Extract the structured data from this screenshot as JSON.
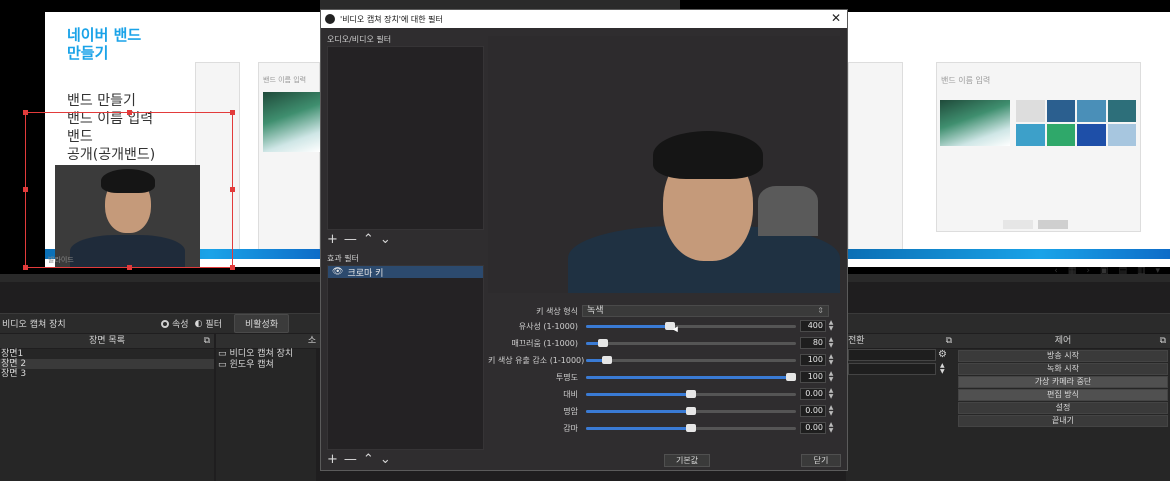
{
  "left_slide": {
    "title": "네이버 밴드\n만들기",
    "body": "밴드 만들기\n밴드 이름 입력\n밴드\n공개(공개밴드)",
    "footer_label": "발라이드",
    "mock_title": "밴드 이름 입력"
  },
  "right_slide": {
    "mock_title": "밴드 이름 입력"
  },
  "toolbar": {
    "source_name": "비디오 캡쳐 장치",
    "properties_label": "속성",
    "filters_label": "필터",
    "deactivate_label": "비활성화"
  },
  "scenes": {
    "header": "장면 목록",
    "items": [
      "장면1",
      "장면 2",
      "장면 3"
    ]
  },
  "sources": {
    "header": "소스",
    "items": [
      "비디오 캡쳐 장치",
      "윈도우 캡쳐"
    ]
  },
  "mixer": {
    "header": "전환"
  },
  "controls": {
    "header": "제어",
    "buttons": [
      "방송 시작",
      "녹화 시작",
      "가상 카메라 중단",
      "편집 방식",
      "설정",
      "끝내기"
    ]
  },
  "dialog": {
    "title": "'비디오 캡쳐 장치'에 대한 필터",
    "audio_video_filters_label": "오디오/비디오 필터",
    "effect_filters_label": "효과 필터",
    "effect_filter_item": "크로마 키",
    "defaults_button": "기본값",
    "close_button": "닫기",
    "tools": {
      "add": "+",
      "remove": "—",
      "up": "⌃",
      "down": "⌄"
    },
    "key_color_type_label": "키 색상 형식",
    "key_color_type_value": "녹색",
    "params": [
      {
        "label": "유사성 (1-1000)",
        "value": "400",
        "fraction": 0.4
      },
      {
        "label": "매끄러움 (1-1000)",
        "value": "80",
        "fraction": 0.08
      },
      {
        "label": "키 색상 유출 감소 (1-1000)",
        "value": "100",
        "fraction": 0.1
      },
      {
        "label": "투명도",
        "value": "100",
        "fraction": 1.0
      },
      {
        "label": "대비",
        "value": "0.00",
        "fraction": 0.5
      },
      {
        "label": "명암",
        "value": "0.00",
        "fraction": 0.5
      },
      {
        "label": "감마",
        "value": "0.00",
        "fraction": 0.5
      }
    ]
  },
  "colors": {
    "accent": "#3a7bd5",
    "selection": "#e23b3b",
    "slide_title": "#1aa3e8"
  }
}
